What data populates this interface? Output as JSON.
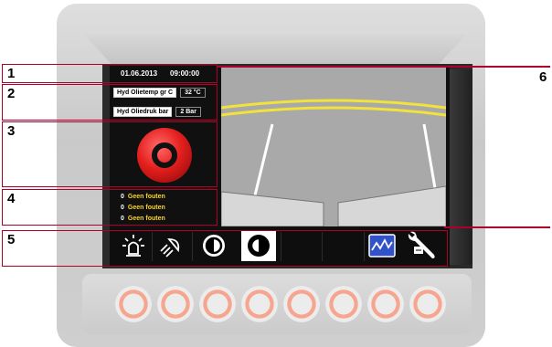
{
  "header": {
    "date": "01.06.2013",
    "time": "09:00:00"
  },
  "sensors": [
    {
      "label": "Hyd Olietemp gr C",
      "value": "32 °C"
    },
    {
      "label": "Hyd Oliedruk bar",
      "value": "2 Bar"
    }
  ],
  "faults": [
    {
      "count": "0",
      "text": "Geen fouten"
    },
    {
      "count": "0",
      "text": "Geen fouten"
    },
    {
      "count": "0",
      "text": "Geen fouten"
    }
  ],
  "callouts": [
    "1",
    "2",
    "3",
    "4",
    "5",
    "6"
  ],
  "toolbar": {
    "icons": [
      "beacon-light-icon",
      "work-light-icon",
      "contrast-down-icon",
      "contrast-up-icon",
      "empty",
      "empty",
      "trend-graph-icon",
      "service-wrench-icon"
    ]
  },
  "colors": {
    "accent": "#b0002a",
    "fault_text": "#ffd21f",
    "estop": "#e5201e"
  }
}
